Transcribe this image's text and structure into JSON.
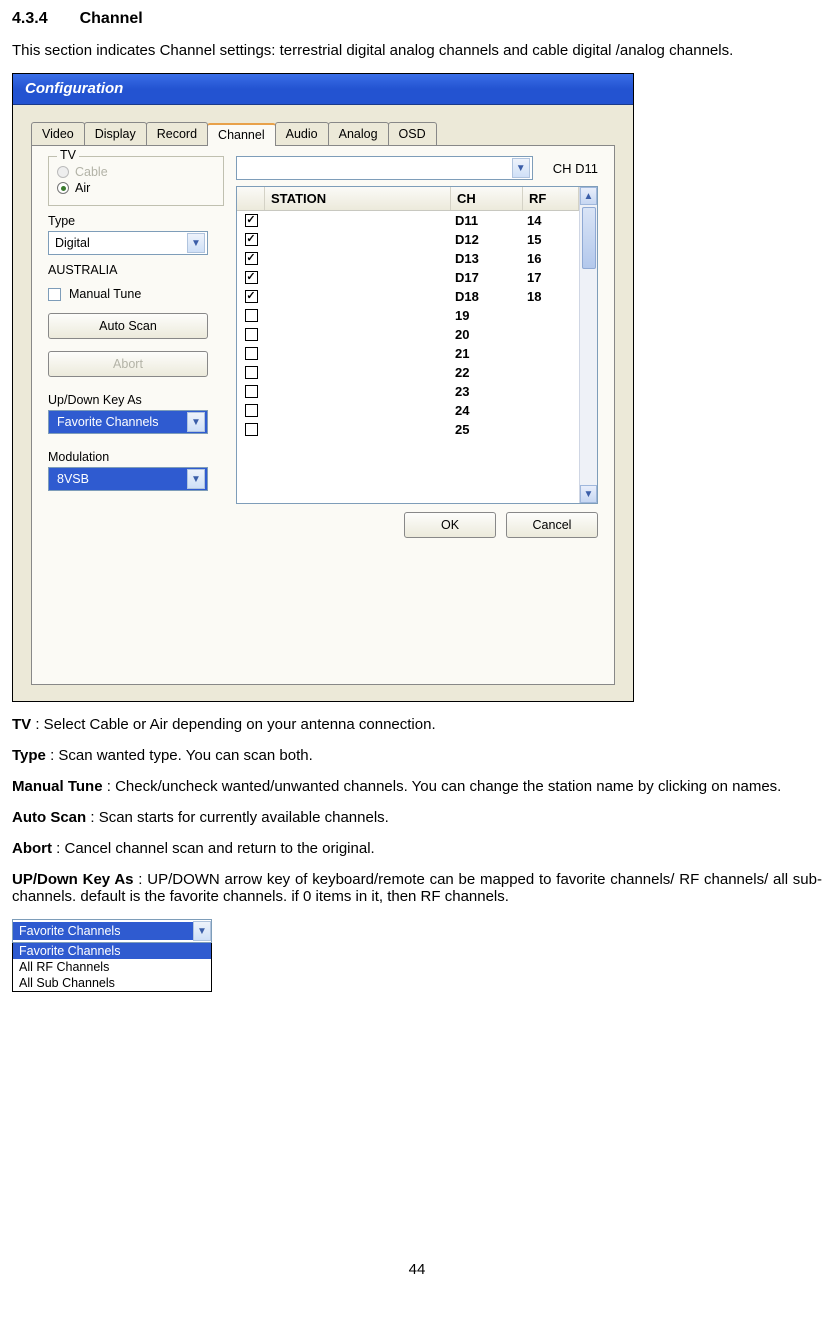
{
  "heading": {
    "number": "4.3.4",
    "title": "Channel"
  },
  "intro": "This section indicates Channel settings: terrestrial digital analog channels and cable digital /analog channels.",
  "window": {
    "title": "Configuration",
    "tabs": [
      "Video",
      "Display",
      "Record",
      "Channel",
      "Audio",
      "Analog",
      "OSD"
    ],
    "active_tab": 3,
    "tv_group": {
      "legend": "TV",
      "cable": "Cable",
      "air": "Air"
    },
    "current_channel_label": "CH D11",
    "type_label": "Type",
    "type_value": "Digital",
    "country_label": "AUSTRALIA",
    "manual_tune_label": "Manual Tune",
    "auto_scan_label": "Auto Scan",
    "abort_label": "Abort",
    "updown_label": "Up/Down Key As",
    "updown_value": "Favorite Channels",
    "modulation_label": "Modulation",
    "modulation_value": "8VSB",
    "list_headers": {
      "station": "STATION",
      "ch": "CH",
      "rf": "RF"
    },
    "channels": [
      {
        "checked": true,
        "station": "",
        "ch": "D11",
        "rf": "14"
      },
      {
        "checked": true,
        "station": "",
        "ch": "D12",
        "rf": "15"
      },
      {
        "checked": true,
        "station": "",
        "ch": "D13",
        "rf": "16"
      },
      {
        "checked": true,
        "station": "",
        "ch": "D17",
        "rf": "17"
      },
      {
        "checked": true,
        "station": "",
        "ch": "D18",
        "rf": "18"
      },
      {
        "checked": false,
        "station": "",
        "ch": "19",
        "rf": ""
      },
      {
        "checked": false,
        "station": "",
        "ch": "20",
        "rf": ""
      },
      {
        "checked": false,
        "station": "",
        "ch": "21",
        "rf": ""
      },
      {
        "checked": false,
        "station": "",
        "ch": "22",
        "rf": ""
      },
      {
        "checked": false,
        "station": "",
        "ch": "23",
        "rf": ""
      },
      {
        "checked": false,
        "station": "",
        "ch": "24",
        "rf": ""
      },
      {
        "checked": false,
        "station": "",
        "ch": "25",
        "rf": ""
      }
    ],
    "ok": "OK",
    "cancel": "Cancel"
  },
  "descriptions": {
    "tv": {
      "term": "TV",
      "text": " : Select Cable or Air depending on your antenna connection."
    },
    "type": {
      "term": "Type",
      "text": " : Scan wanted type. You can scan both."
    },
    "manual": {
      "term": "Manual Tune",
      "text": " : Check/uncheck wanted/unwanted channels. You can change the station name by clicking on names."
    },
    "autoscan": {
      "term": "Auto Scan",
      "text": " : Scan starts for currently available channels."
    },
    "abort": {
      "term": "Abort",
      "text": " : Cancel channel scan and return to the original."
    },
    "updown": {
      "term": "UP/Down Key As",
      "text": " : UP/DOWN arrow key of keyboard/remote can be mapped to favorite channels/ RF channels/ all sub-channels. default is the favorite channels. if 0 items in it, then RF channels."
    }
  },
  "dropdown_figure": {
    "selected": "Favorite Channels",
    "options": [
      "Favorite Channels",
      "All RF Channels",
      "All Sub Channels"
    ]
  },
  "page_number": "44"
}
